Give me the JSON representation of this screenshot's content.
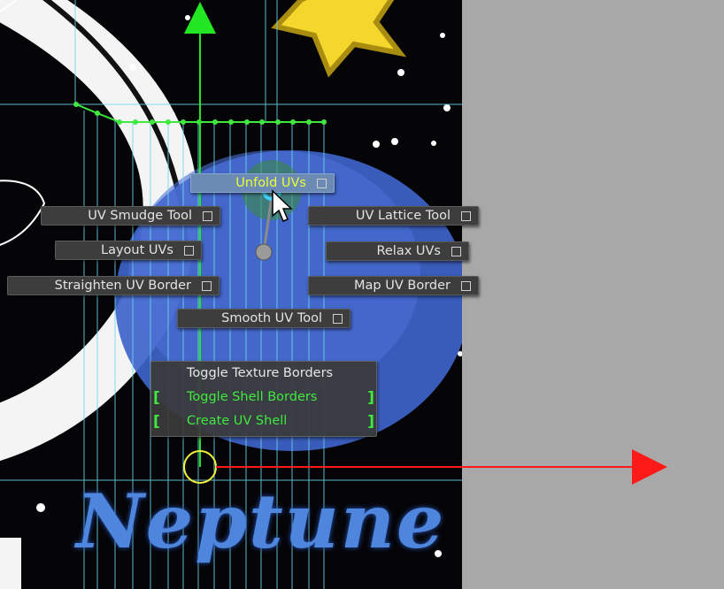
{
  "viewport": {
    "title_text": "Neptune"
  },
  "marking_menu": {
    "north": {
      "label": "Unfold UVs",
      "active": true
    },
    "west_1": {
      "label": "UV Smudge Tool"
    },
    "west_2": {
      "label": "Layout UVs"
    },
    "west_3": {
      "label": "Straighten UV Border"
    },
    "east_1": {
      "label": "UV Lattice Tool"
    },
    "east_2": {
      "label": "Relax UVs"
    },
    "east_3": {
      "label": "Map UV Border"
    },
    "south": {
      "label": "Smooth UV Tool"
    }
  },
  "shell_panel": {
    "items": [
      {
        "label": "Toggle Texture Borders",
        "checked": false
      },
      {
        "label": "Toggle Shell Borders",
        "checked": true
      },
      {
        "label": "Create UV Shell",
        "checked": true
      }
    ]
  },
  "colors": {
    "active_item_bg": "#6b8bb5",
    "active_text": "#eaff37",
    "checked_text": "#3fe93f",
    "axis_y": "#22e622",
    "axis_x": "#ff1a1a",
    "gridline": "#6fd5f0",
    "viewport_bg": "#050508",
    "side_bg": "#a8a8a8"
  },
  "icons": [
    "mouse-cursor-icon",
    "y-axis-arrow-icon",
    "x-axis-arrow-icon",
    "option-box-icon",
    "pivot-circle-icon",
    "star-icon"
  ]
}
